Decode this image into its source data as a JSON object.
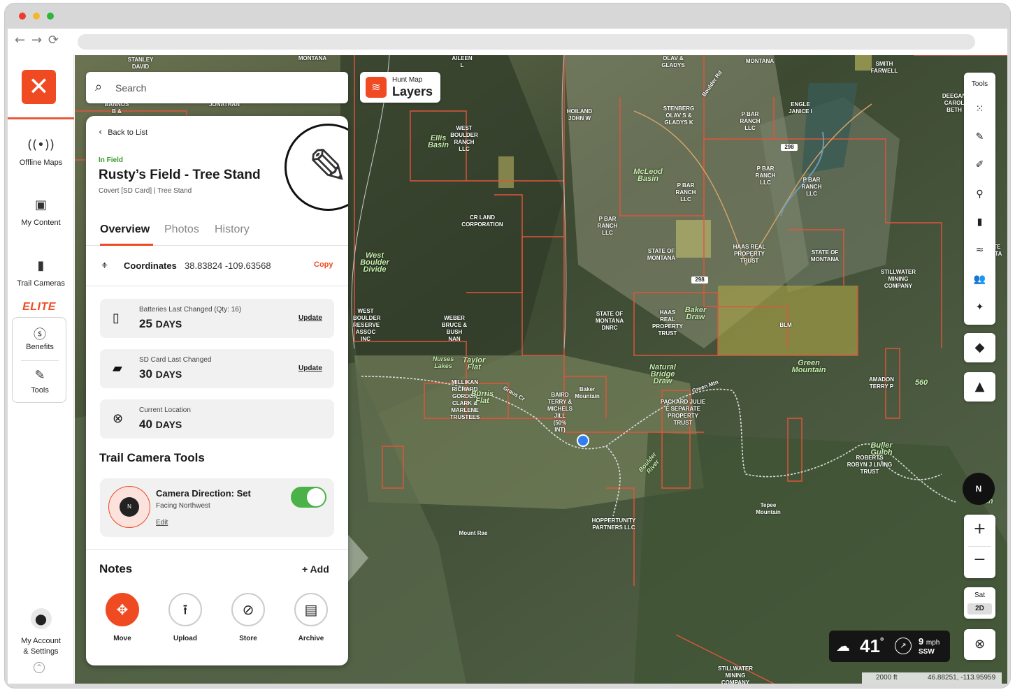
{
  "nav": {
    "offline_maps": "Offline Maps",
    "my_content": "My Content",
    "trail_cameras": "Trail Cameras",
    "elite": "ELITE",
    "benefits": "Benefits",
    "tools": "Tools",
    "account": "My Account\n& Settings"
  },
  "search": {
    "placeholder": "Search"
  },
  "layers": {
    "small": "Hunt Map",
    "big": "Layers"
  },
  "panel": {
    "back": "Back to List",
    "status": "In Field",
    "title": "Rusty’s Field - Tree Stand",
    "subtitle": "Covert [SD Card] | Tree Stand",
    "tabs": [
      "Overview",
      "Photos",
      "History"
    ],
    "coordinates_label": "Coordinates",
    "coordinates_value": "38.83824  -109.63568",
    "copy": "Copy",
    "cards": [
      {
        "label": "Batteries Last Changed (Qty: 16)",
        "value": "25",
        "unit": "DAYS",
        "action": "Update"
      },
      {
        "label": "SD Card Last Changed",
        "value": "30",
        "unit": "DAYS",
        "action": "Update"
      },
      {
        "label": "Current Location",
        "value": "40",
        "unit": "DAYS",
        "action": ""
      }
    ],
    "tools_title": "Trail Camera Tools",
    "camera_direction_title": "Camera Direction: Set",
    "camera_direction_sub": "Facing Northwest",
    "camera_direction_edit": "Edit",
    "camera_compass_letter": "N",
    "notes_title": "Notes",
    "notes_add": "+ Add",
    "actions": [
      "Move",
      "Upload",
      "Store",
      "Archive"
    ]
  },
  "tools": {
    "label": "Tools"
  },
  "compass": "N",
  "mapmode": {
    "line1": "Sat",
    "line2": "2D"
  },
  "weather": {
    "temp": "41",
    "deg": "°",
    "speed": "9",
    "speed_unit": "mph",
    "direction": "SSW"
  },
  "scale": {
    "distance": "2000 ft",
    "coords": "46.88251, -113.95959"
  },
  "map_labels": [
    "STANLEY DAVID",
    "MONTANA",
    "AILEEN L",
    "OLAV & GLADYS",
    "MONTANA",
    "SMITH FARWELL",
    "BANNOS B &",
    "JONATHAN",
    "HOILAND JOHN W",
    "STENBERG OLAV S & GLADYS K",
    "P BAR RANCH LLC",
    "ENGLE JANICE I",
    "DEEGAN CAROL BETH",
    "WEST BOULDER RANCH LLC",
    "Ellis Basin",
    "McLeod Basin",
    "P BAR RANCH LLC",
    "P BAR RANCH LLC",
    "P BAR RANCH LLC",
    "CR LAND CORPORATION",
    "P BAR RANCH LLC",
    "West Boulder Divide",
    "STATE OF MONTANA",
    "HAAS REAL PROPERTY TRUST",
    "STATE OF MONTANA",
    "STILLWATER MINING COMPANY",
    "STATE MONTA",
    "WEST BOULDER RESERVE ASSOC INC",
    "WEBER BRUCE & BUSH NAN",
    "STATE OF MONTANA DNRC",
    "HAAS REAL PROPERTY TRUST",
    "Baker Draw",
    "BLM",
    "Green Mountain",
    "AMADON TERRY P",
    "560",
    "Nurses Lakes",
    "Taylor Flat",
    "MILLIKAN RICHARD GORDON CLARK & MARLENE TRUSTEES",
    "Burris Flat",
    "Baker Mountain",
    "BAIRD TERRY & MICHELS JILL (50% INT)",
    "Natural Bridge Draw",
    "PACKARD JULIE E SEPARATE PROPERTY TRUST",
    "ROBERTS ROBYN J LIVING TRUST",
    "Buller Gulch",
    "Gulch",
    "HOPPERTUNITY PARTNERS LLC",
    "Boulder River",
    "Tepee Mountain",
    "Mount Rae",
    "STILLWATER MINING COMPANY",
    "Green Mtn",
    "Graus Cr",
    "Boulder Rd",
    "298",
    "298"
  ]
}
